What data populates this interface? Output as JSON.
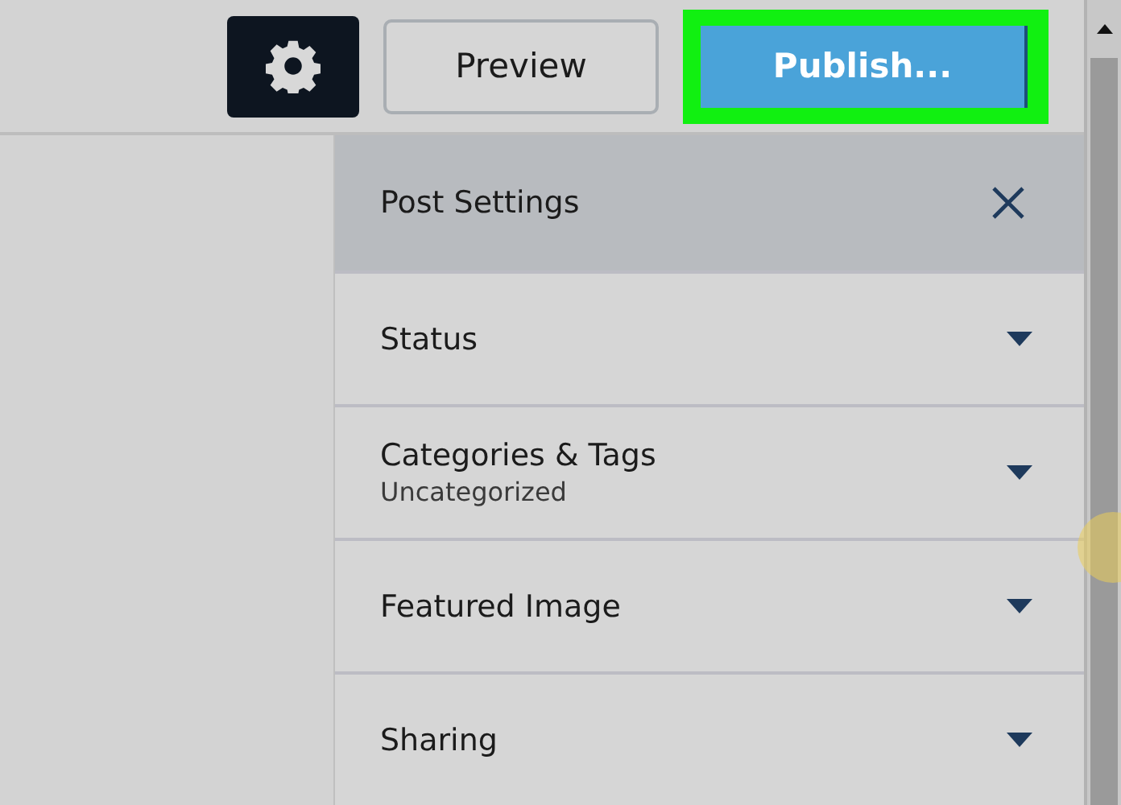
{
  "toolbar": {
    "preview_label": "Preview",
    "publish": {
      "label": "Publish...",
      "highlighted": true
    }
  },
  "sidebar": {
    "title": "Post Settings",
    "panels": [
      {
        "title": "Status",
        "expanded": false
      },
      {
        "title": "Categories & Tags",
        "subtitle": "Uncategorized",
        "expanded": false
      },
      {
        "title": "Featured Image",
        "expanded": false
      },
      {
        "title": "Sharing",
        "expanded": false
      }
    ]
  }
}
